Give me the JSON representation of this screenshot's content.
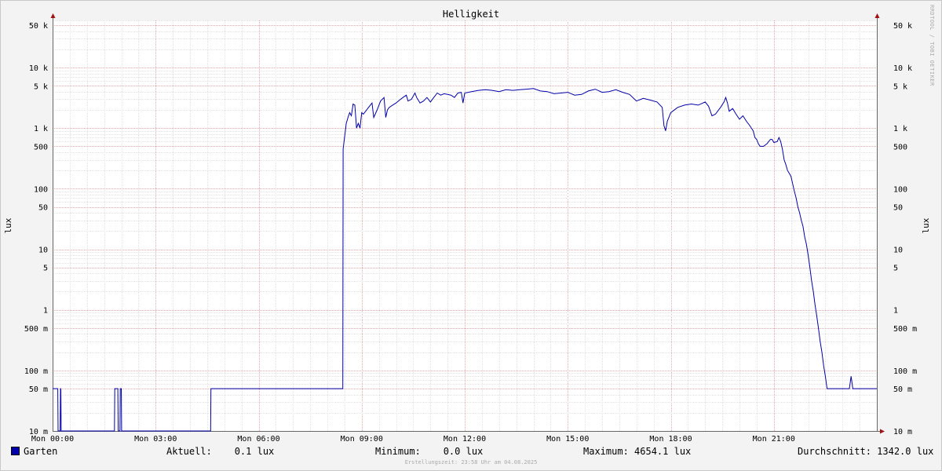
{
  "header": {
    "title": "Helligkeit"
  },
  "watermark": "RRDTOOL / TOBI OETIKER",
  "legend": {
    "series_name": "Garten",
    "series_color": "#0000aa",
    "current": "Aktuell:    0.1 lux",
    "minimum": "Minimum:    0.0 lux",
    "maximum": "Maximum: 4654.1 lux",
    "average": "Durchschnitt: 1342.0 lux"
  },
  "footer": "Erstellungszeit: 23:58 Uhr am 04.08.2025",
  "chart_data": {
    "type": "line",
    "title": "Helligkeit",
    "ylabel": "lux",
    "y_scale": "log",
    "ylim": [
      0.01,
      60000
    ],
    "xlim_hours": [
      0,
      24
    ],
    "x_tick_labels": [
      "Mon 00:00",
      "Mon 03:00",
      "Mon 06:00",
      "Mon 09:00",
      "Mon 12:00",
      "Mon 15:00",
      "Mon 18:00",
      "Mon 21:00"
    ],
    "y_ticks": [
      {
        "value": 0.01,
        "label": "10 m"
      },
      {
        "value": 0.05,
        "label": "50 m"
      },
      {
        "value": 0.1,
        "label": "100 m"
      },
      {
        "value": 0.5,
        "label": "500 m"
      },
      {
        "value": 1,
        "label": "1"
      },
      {
        "value": 5,
        "label": "5"
      },
      {
        "value": 10,
        "label": "10"
      },
      {
        "value": 50,
        "label": "50"
      },
      {
        "value": 100,
        "label": "100"
      },
      {
        "value": 500,
        "label": "500"
      },
      {
        "value": 1000,
        "label": "1 k"
      },
      {
        "value": 5000,
        "label": "5 k"
      },
      {
        "value": 10000,
        "label": "10 k"
      },
      {
        "value": 50000,
        "label": "50 k"
      }
    ],
    "grid": true,
    "series": [
      {
        "name": "Garten",
        "color": "#0000aa",
        "points": [
          [
            0.0,
            0.05
          ],
          [
            0.15,
            0.05
          ],
          [
            0.16,
            0.01
          ],
          [
            0.22,
            0.01
          ],
          [
            0.23,
            0.05
          ],
          [
            0.24,
            0.05
          ],
          [
            0.25,
            0.01
          ],
          [
            1.8,
            0.01
          ],
          [
            1.81,
            0.05
          ],
          [
            1.9,
            0.05
          ],
          [
            1.91,
            0.01
          ],
          [
            1.96,
            0.01
          ],
          [
            1.97,
            0.05
          ],
          [
            2.0,
            0.05
          ],
          [
            2.01,
            0.01
          ],
          [
            4.6,
            0.01
          ],
          [
            4.61,
            0.05
          ],
          [
            8.45,
            0.05
          ],
          [
            8.46,
            450
          ],
          [
            8.5,
            700
          ],
          [
            8.55,
            1200
          ],
          [
            8.6,
            1500
          ],
          [
            8.65,
            1800
          ],
          [
            8.7,
            1600
          ],
          [
            8.75,
            2500
          ],
          [
            8.8,
            2400
          ],
          [
            8.85,
            1000
          ],
          [
            8.9,
            1200
          ],
          [
            8.95,
            1000
          ],
          [
            9.0,
            1800
          ],
          [
            9.05,
            1700
          ],
          [
            9.2,
            2200
          ],
          [
            9.3,
            2600
          ],
          [
            9.35,
            1500
          ],
          [
            9.45,
            2000
          ],
          [
            9.55,
            2800
          ],
          [
            9.65,
            3200
          ],
          [
            9.7,
            1500
          ],
          [
            9.75,
            2000
          ],
          [
            9.8,
            2200
          ],
          [
            9.9,
            2400
          ],
          [
            10.0,
            2600
          ],
          [
            10.1,
            2900
          ],
          [
            10.2,
            3200
          ],
          [
            10.3,
            3500
          ],
          [
            10.35,
            2800
          ],
          [
            10.45,
            3000
          ],
          [
            10.55,
            3800
          ],
          [
            10.6,
            3200
          ],
          [
            10.7,
            2600
          ],
          [
            10.8,
            2800
          ],
          [
            10.9,
            3200
          ],
          [
            11.0,
            2700
          ],
          [
            11.1,
            3200
          ],
          [
            11.2,
            3800
          ],
          [
            11.3,
            3500
          ],
          [
            11.4,
            3700
          ],
          [
            11.5,
            3600
          ],
          [
            11.6,
            3500
          ],
          [
            11.7,
            3200
          ],
          [
            11.8,
            3800
          ],
          [
            11.9,
            3900
          ],
          [
            11.95,
            2600
          ],
          [
            12.0,
            3800
          ],
          [
            12.2,
            4000
          ],
          [
            12.4,
            4200
          ],
          [
            12.6,
            4300
          ],
          [
            12.8,
            4200
          ],
          [
            13.0,
            4000
          ],
          [
            13.2,
            4300
          ],
          [
            13.4,
            4200
          ],
          [
            13.6,
            4300
          ],
          [
            13.8,
            4400
          ],
          [
            14.0,
            4500
          ],
          [
            14.2,
            4100
          ],
          [
            14.4,
            4000
          ],
          [
            14.6,
            3700
          ],
          [
            14.8,
            3800
          ],
          [
            15.0,
            3900
          ],
          [
            15.2,
            3500
          ],
          [
            15.4,
            3600
          ],
          [
            15.6,
            4100
          ],
          [
            15.8,
            4400
          ],
          [
            16.0,
            3900
          ],
          [
            16.2,
            4000
          ],
          [
            16.4,
            4300
          ],
          [
            16.6,
            3900
          ],
          [
            16.8,
            3600
          ],
          [
            17.0,
            2800
          ],
          [
            17.2,
            3100
          ],
          [
            17.4,
            2900
          ],
          [
            17.6,
            2700
          ],
          [
            17.75,
            2200
          ],
          [
            17.8,
            1100
          ],
          [
            17.85,
            900
          ],
          [
            17.9,
            1300
          ],
          [
            18.0,
            1800
          ],
          [
            18.2,
            2200
          ],
          [
            18.4,
            2400
          ],
          [
            18.6,
            2500
          ],
          [
            18.8,
            2400
          ],
          [
            19.0,
            2700
          ],
          [
            19.1,
            2300
          ],
          [
            19.2,
            1600
          ],
          [
            19.3,
            1700
          ],
          [
            19.45,
            2200
          ],
          [
            19.55,
            2700
          ],
          [
            19.6,
            3200
          ],
          [
            19.65,
            2600
          ],
          [
            19.7,
            1900
          ],
          [
            19.8,
            2100
          ],
          [
            19.9,
            1700
          ],
          [
            20.0,
            1400
          ],
          [
            20.1,
            1600
          ],
          [
            20.2,
            1300
          ],
          [
            20.3,
            1100
          ],
          [
            20.4,
            900
          ],
          [
            20.45,
            700
          ],
          [
            20.5,
            650
          ],
          [
            20.55,
            550
          ],
          [
            20.6,
            500
          ],
          [
            20.7,
            500
          ],
          [
            20.8,
            550
          ],
          [
            20.85,
            600
          ],
          [
            20.9,
            650
          ],
          [
            20.95,
            650
          ],
          [
            21.0,
            580
          ],
          [
            21.1,
            600
          ],
          [
            21.15,
            700
          ],
          [
            21.2,
            600
          ],
          [
            21.25,
            450
          ],
          [
            21.3,
            300
          ],
          [
            21.35,
            250
          ],
          [
            21.4,
            200
          ],
          [
            21.45,
            180
          ],
          [
            21.5,
            160
          ],
          [
            21.55,
            120
          ],
          [
            21.6,
            90
          ],
          [
            21.65,
            70
          ],
          [
            21.7,
            50
          ],
          [
            21.75,
            40
          ],
          [
            21.8,
            30
          ],
          [
            21.85,
            24
          ],
          [
            21.9,
            16
          ],
          [
            21.95,
            12
          ],
          [
            22.0,
            8
          ],
          [
            22.05,
            5
          ],
          [
            22.1,
            3
          ],
          [
            22.15,
            2
          ],
          [
            22.2,
            1.2
          ],
          [
            22.25,
            0.8
          ],
          [
            22.3,
            0.5
          ],
          [
            22.35,
            0.3
          ],
          [
            22.4,
            0.2
          ],
          [
            22.45,
            0.12
          ],
          [
            22.5,
            0.08
          ],
          [
            22.55,
            0.05
          ],
          [
            23.2,
            0.05
          ],
          [
            23.25,
            0.08
          ],
          [
            23.3,
            0.05
          ],
          [
            24.0,
            0.05
          ]
        ]
      }
    ]
  }
}
